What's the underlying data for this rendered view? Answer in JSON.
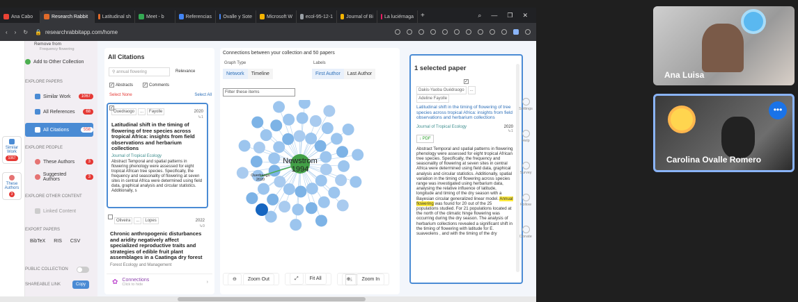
{
  "tabs": [
    {
      "label": "Ana Cabo",
      "color": "#ea4335",
      "active": false
    },
    {
      "label": "Research Rabbit",
      "color": "#e06a2a",
      "active": true
    },
    {
      "label": "Latitudinal sh",
      "color": "#e06a2a",
      "active": false
    },
    {
      "label": "Meet - b",
      "color": "#34a853",
      "active": false
    },
    {
      "label": "Referencias",
      "color": "#4285f4",
      "active": false
    },
    {
      "label": "Ovalle y Sote",
      "color": "#4285f4",
      "active": false
    },
    {
      "label": "Microsoft W",
      "color": "#f4b400",
      "active": false
    },
    {
      "label": "ecol-95-12-1",
      "color": "#9aa0a6",
      "active": false
    },
    {
      "label": "Journal of Bi",
      "color": "#f4b400",
      "active": false
    },
    {
      "label": "La luciérnaga",
      "color": "#e91e63",
      "active": false
    }
  ],
  "url": "researchrabbitapp.com/home",
  "rail": {
    "similar_label_1": "Similar",
    "similar_label_2": "Work",
    "similar_count": "1067",
    "these_label_1": "These",
    "these_label_2": "Authors",
    "these_count": "3"
  },
  "sidebar": {
    "remove_label": "Remove from",
    "remove_sub": "Frequency flowering",
    "add_other": "Add to Other Collection",
    "explore_papers": "EXPLORE PAPERS",
    "similar_work": "Similar Work",
    "similar_work_count": "1067",
    "all_references": "All References",
    "all_references_count": "68",
    "all_citations": "All Citations",
    "all_citations_count": "558",
    "explore_people": "EXPLORE PEOPLE",
    "these_authors": "These Authors",
    "these_authors_count": "3",
    "suggested_authors": "Suggested Authors",
    "suggested_authors_count": "3",
    "explore_other": "EXPLORE OTHER CONTENT",
    "linked_content": "Linked Content",
    "export_papers": "EXPORT PAPERS",
    "export_bibtex": "BibTeX",
    "export_ris": "RIS",
    "export_csv": "CSV",
    "public_collection": "PUBLIC COLLECTION",
    "shareable_link": "SHAREABLE LINK",
    "copy": "Copy"
  },
  "citations": {
    "title": "All Citations",
    "search_value": "annual flowering",
    "sort": "Relevance",
    "abstracts": "Abstracts",
    "comments": "Comments",
    "select_none": "Select None",
    "select_all": "Select All",
    "paper1": {
      "author1": "Ouedraogo",
      "ellipsis": "...",
      "author2": "Fayolle",
      "year": "2020",
      "count": "↳1",
      "title": "Latitudinal shift in the timing of flowering of tree species across tropical Africa: insights from field observations and herbarium collections",
      "journal": "Journal of Tropical Ecology",
      "abstract": "Abstract Temporal and spatial patterns in flowering phenology were assessed for eight tropical African tree species. Specifically, the frequency and seasonality of flowering at seven sites in central Africa were determined using field data, graphical analysis and circular statistics. Additionally, s"
    },
    "paper2": {
      "author1": "Oliveira",
      "ellipsis": "...",
      "author2": "Lopes",
      "year": "2022",
      "count": "↳0",
      "title": "Chronic anthropogenic disturbances and aridity negatively affect specialized reproductive traits and strategies of edible fruit plant assemblages in a Caatinga dry forest",
      "journal": "Forest Ecology and Management"
    },
    "connections": "Connections",
    "connections_sub": "Click to hide"
  },
  "graph": {
    "header": "Connections between your collection and 50 papers",
    "graph_type_label": "Graph Type",
    "network": "Network",
    "timeline": "Timeline",
    "labels_label": "Labels",
    "first_author": "First Author",
    "last_author": "Last Author",
    "filter_placeholder": "Filter these items",
    "center_name": "Newstrom",
    "center_year": "1994",
    "node_name": "Ouedraogo",
    "node_year": "2020",
    "zoom_out": "Zoom Out",
    "fit_all": "Fit All",
    "zoom_in": "Zoom In"
  },
  "selected": {
    "title": "1 selected paper",
    "author1": "Dakis-Yaoba Ouédraogo",
    "ellipsis": "...",
    "author2": "Adeline Fayolle",
    "paper_title": "Latitudinal shift in the timing of flowering of tree species across tropical Africa: insights from field observations and herbarium collections",
    "journal": "Journal of Tropical Ecology",
    "year": "2020",
    "count": "↳1",
    "pdf": "↓ PDF",
    "abstract_a": "Abstract Temporal and spatial patterns in flowering phenology were assessed for eight tropical African tree species. Specifically, the frequency and seasonality of flowering at seven sites in central Africa were determined using field data, graphical analysis and circular statistics. Additionally, spatial variation in the timing of flowering across species range was investigated using herbarium data, analysing the relative influence of latitude, longitude and timing of the dry season with a Bayesian circular generalized linear model.",
    "highlight": "Annual flowering",
    "abstract_b": "was found for 20 out of the 25 populations studied. For 21 populations located at the north of the climatic hinge flowering was occurring during the dry season. The analysis of herbarium collections revealed a significant shift in the timing of flowering with latitude for E. suaveolens , and with the timing of the dry"
  },
  "tools": {
    "settings": "Settings",
    "help": "Help",
    "survey": "Survey",
    "follow": "Follow",
    "donate": "Donate"
  },
  "participants": {
    "p1": "Ana Luisa",
    "p2": "Carolina Ovalle Romero"
  }
}
